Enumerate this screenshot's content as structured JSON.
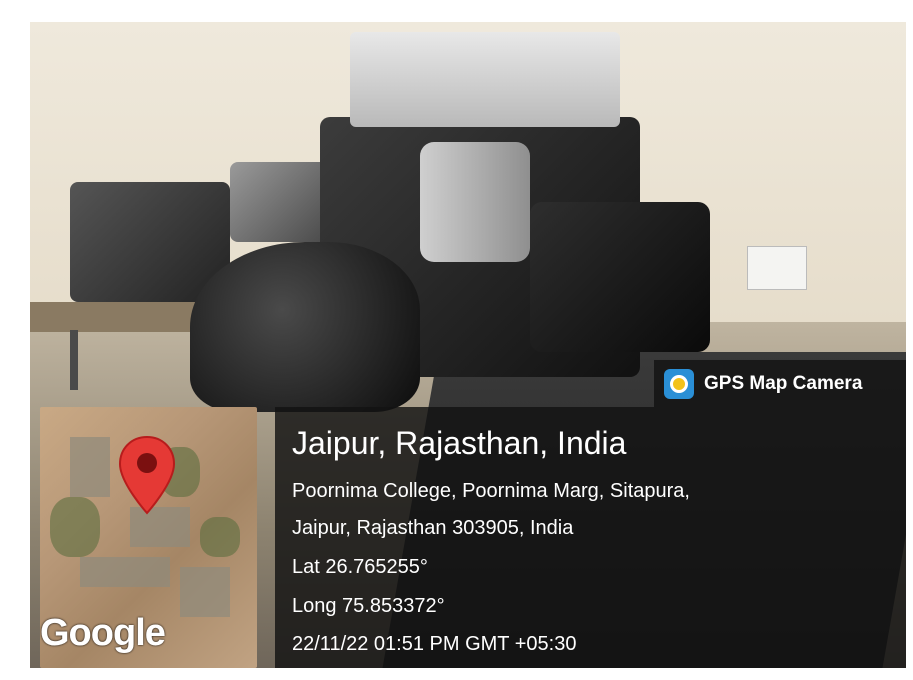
{
  "badge": {
    "label": "GPS Map Camera",
    "icon": "gps-map-camera-app-icon"
  },
  "location": {
    "title": "Jaipur, Rajasthan, India",
    "address_line1": "Poornima College, Poornima Marg, Sitapura,",
    "address_line2": "Jaipur, Rajasthan 303905, India",
    "lat": "Lat 26.765255°",
    "long": "Long 75.853372°",
    "datetime": "22/11/22 01:51 PM GMT +05:30"
  },
  "map": {
    "watermark": "Google",
    "marker_icon": "map-pin-icon"
  },
  "colors": {
    "overlay": "#121212",
    "marker": "#e53935",
    "badge_icon": "#2a8fd6"
  }
}
